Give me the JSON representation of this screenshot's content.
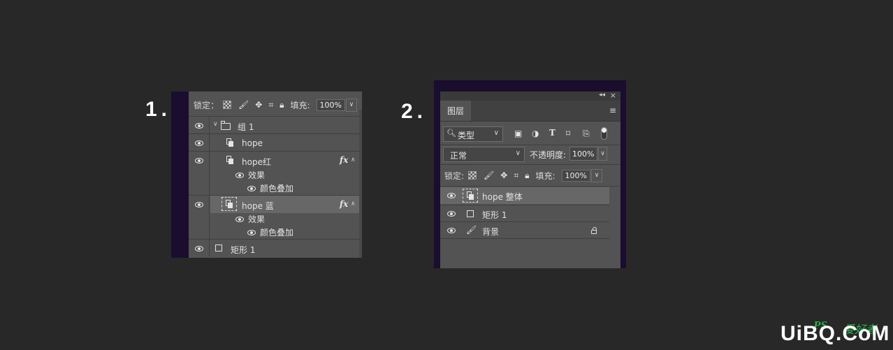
{
  "steps": {
    "one": "1.",
    "two": "2."
  },
  "panel1": {
    "lock_label": "锁定：",
    "fill_label": "填充:",
    "fill_value": "100%",
    "layers": [
      {
        "name": "组 1",
        "type": "group",
        "expanded": true
      },
      {
        "name": "hope",
        "type": "smart-object"
      },
      {
        "name": "hope红",
        "type": "smart-object",
        "fx": "fx",
        "effects_label": "效果",
        "effects": [
          "颜色叠加"
        ]
      },
      {
        "name": "hope 蓝",
        "type": "smart-object",
        "selected": true,
        "fx": "fx",
        "effects_label": "效果",
        "effects": [
          "颜色叠加"
        ]
      },
      {
        "name": "矩形 1",
        "type": "shape"
      }
    ]
  },
  "panel2": {
    "tab_label": "图层",
    "filter_label": "类型",
    "blend_mode": "正常",
    "opacity_label": "不透明度:",
    "opacity_value": "100%",
    "lock_label": "锁定:",
    "fill_label": "填充:",
    "fill_value": "100%",
    "layers": [
      {
        "name": "hope 整体",
        "type": "smart-object",
        "selected": true
      },
      {
        "name": "矩形 1",
        "type": "shape"
      },
      {
        "name": "背景",
        "type": "background",
        "locked": true
      }
    ]
  },
  "watermark": {
    "main": "UiBQ.CoM",
    "brand": "PS",
    "cn": "爱好者"
  },
  "colors": {
    "canvas": "#282828",
    "panel": "#535353",
    "panel_frame": "#1a0d2e",
    "selected_row": "#676767",
    "watermark_green": "#2ab34a"
  }
}
